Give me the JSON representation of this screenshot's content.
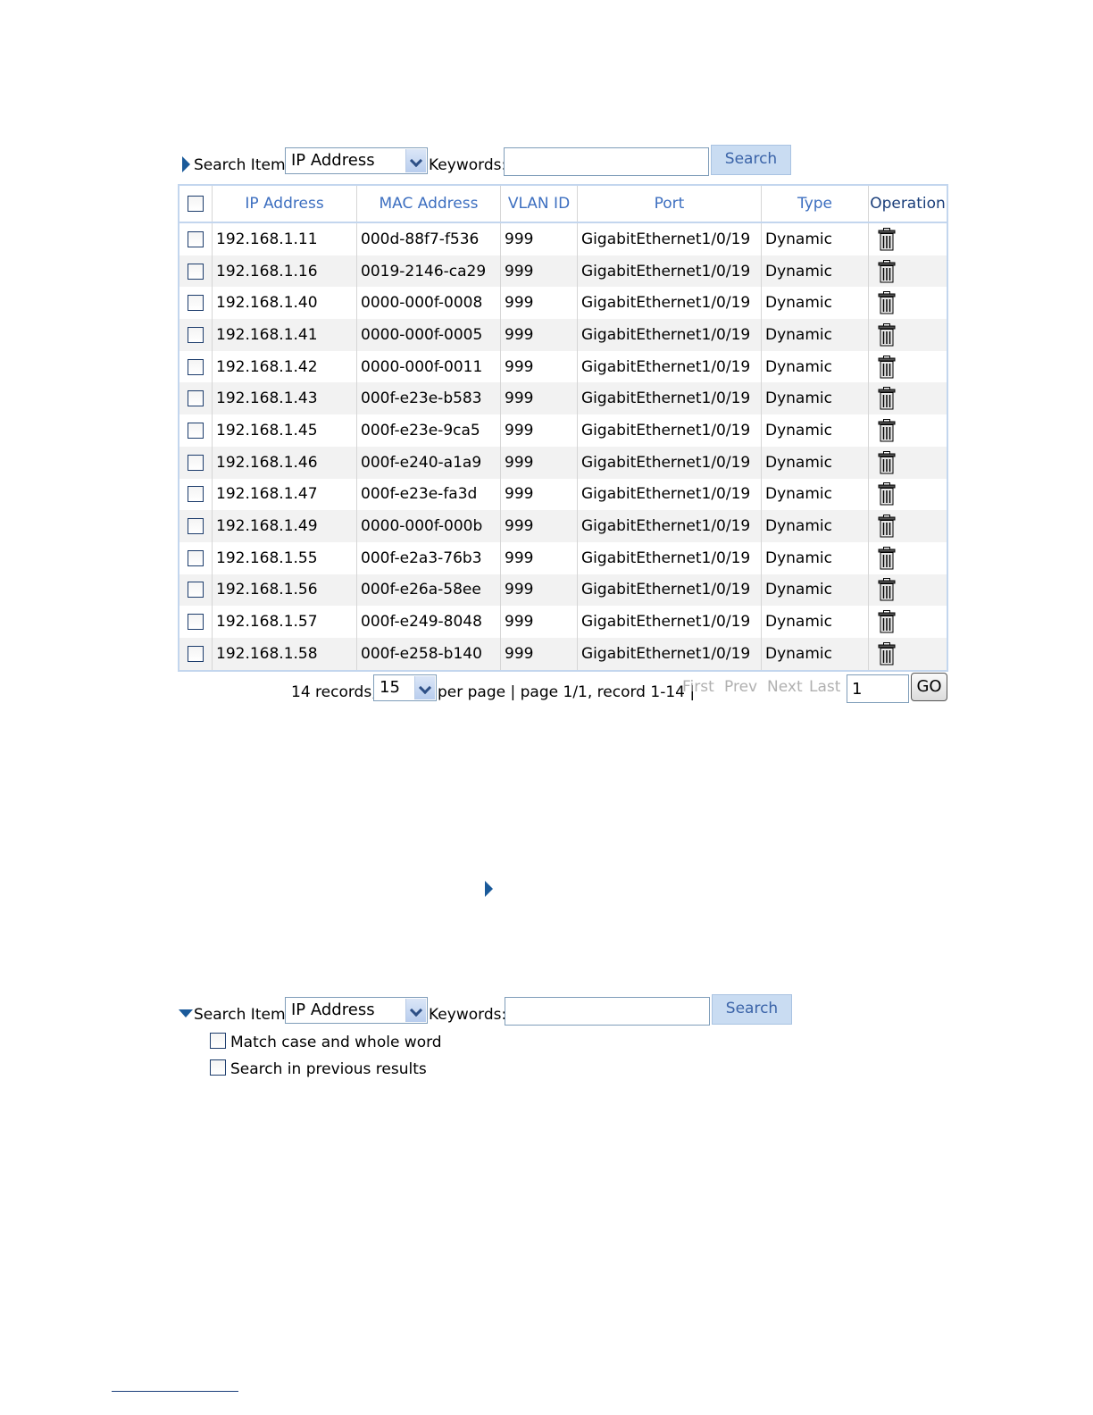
{
  "search1": {
    "label": "Search Item:",
    "item_value": "IP Address",
    "keywords_label": "Keywords:",
    "keywords_value": "",
    "search_button": "Search"
  },
  "table": {
    "headers": [
      "IP Address",
      "MAC Address",
      "VLAN ID",
      "Port",
      "Type",
      "Operation"
    ],
    "rows": [
      {
        "ip": "192.168.1.11",
        "mac": "000d-88f7-f536",
        "vlan": "999",
        "port": "GigabitEthernet1/0/19",
        "type": "Dynamic"
      },
      {
        "ip": "192.168.1.16",
        "mac": "0019-2146-ca29",
        "vlan": "999",
        "port": "GigabitEthernet1/0/19",
        "type": "Dynamic"
      },
      {
        "ip": "192.168.1.40",
        "mac": "0000-000f-0008",
        "vlan": "999",
        "port": "GigabitEthernet1/0/19",
        "type": "Dynamic"
      },
      {
        "ip": "192.168.1.41",
        "mac": "0000-000f-0005",
        "vlan": "999",
        "port": "GigabitEthernet1/0/19",
        "type": "Dynamic"
      },
      {
        "ip": "192.168.1.42",
        "mac": "0000-000f-0011",
        "vlan": "999",
        "port": "GigabitEthernet1/0/19",
        "type": "Dynamic"
      },
      {
        "ip": "192.168.1.43",
        "mac": "000f-e23e-b583",
        "vlan": "999",
        "port": "GigabitEthernet1/0/19",
        "type": "Dynamic"
      },
      {
        "ip": "192.168.1.45",
        "mac": "000f-e23e-9ca5",
        "vlan": "999",
        "port": "GigabitEthernet1/0/19",
        "type": "Dynamic"
      },
      {
        "ip": "192.168.1.46",
        "mac": "000f-e240-a1a9",
        "vlan": "999",
        "port": "GigabitEthernet1/0/19",
        "type": "Dynamic"
      },
      {
        "ip": "192.168.1.47",
        "mac": "000f-e23e-fa3d",
        "vlan": "999",
        "port": "GigabitEthernet1/0/19",
        "type": "Dynamic"
      },
      {
        "ip": "192.168.1.49",
        "mac": "0000-000f-000b",
        "vlan": "999",
        "port": "GigabitEthernet1/0/19",
        "type": "Dynamic"
      },
      {
        "ip": "192.168.1.55",
        "mac": "000f-e2a3-76b3",
        "vlan": "999",
        "port": "GigabitEthernet1/0/19",
        "type": "Dynamic"
      },
      {
        "ip": "192.168.1.56",
        "mac": "000f-e26a-58ee",
        "vlan": "999",
        "port": "GigabitEthernet1/0/19",
        "type": "Dynamic"
      },
      {
        "ip": "192.168.1.57",
        "mac": "000f-e249-8048",
        "vlan": "999",
        "port": "GigabitEthernet1/0/19",
        "type": "Dynamic"
      },
      {
        "ip": "192.168.1.58",
        "mac": "000f-e258-b140",
        "vlan": "999",
        "port": "GigabitEthernet1/0/19",
        "type": "Dynamic"
      }
    ],
    "operation_icon": "trash-icon"
  },
  "pager": {
    "records": "14 records,",
    "per_page_value": "15",
    "info": "per page | page 1/1, record 1-14 |",
    "first": "First",
    "prev": "Prev",
    "next": "Next",
    "last": "Last",
    "page_input": "1",
    "go": "GO"
  },
  "search2": {
    "label": "Search Item:",
    "item_value": "IP Address",
    "keywords_label": "Keywords:",
    "keywords_value": "",
    "search_button": "Search",
    "option_match": "Match case and whole word",
    "option_previous": "Search in previous results"
  },
  "colors": {
    "accent": "#1a5a9a",
    "header_text": "#3d6fc0",
    "table_border": "#c3d6ee",
    "alt_row": "#f2f2f2",
    "disabled_link": "#b0b0b0"
  }
}
